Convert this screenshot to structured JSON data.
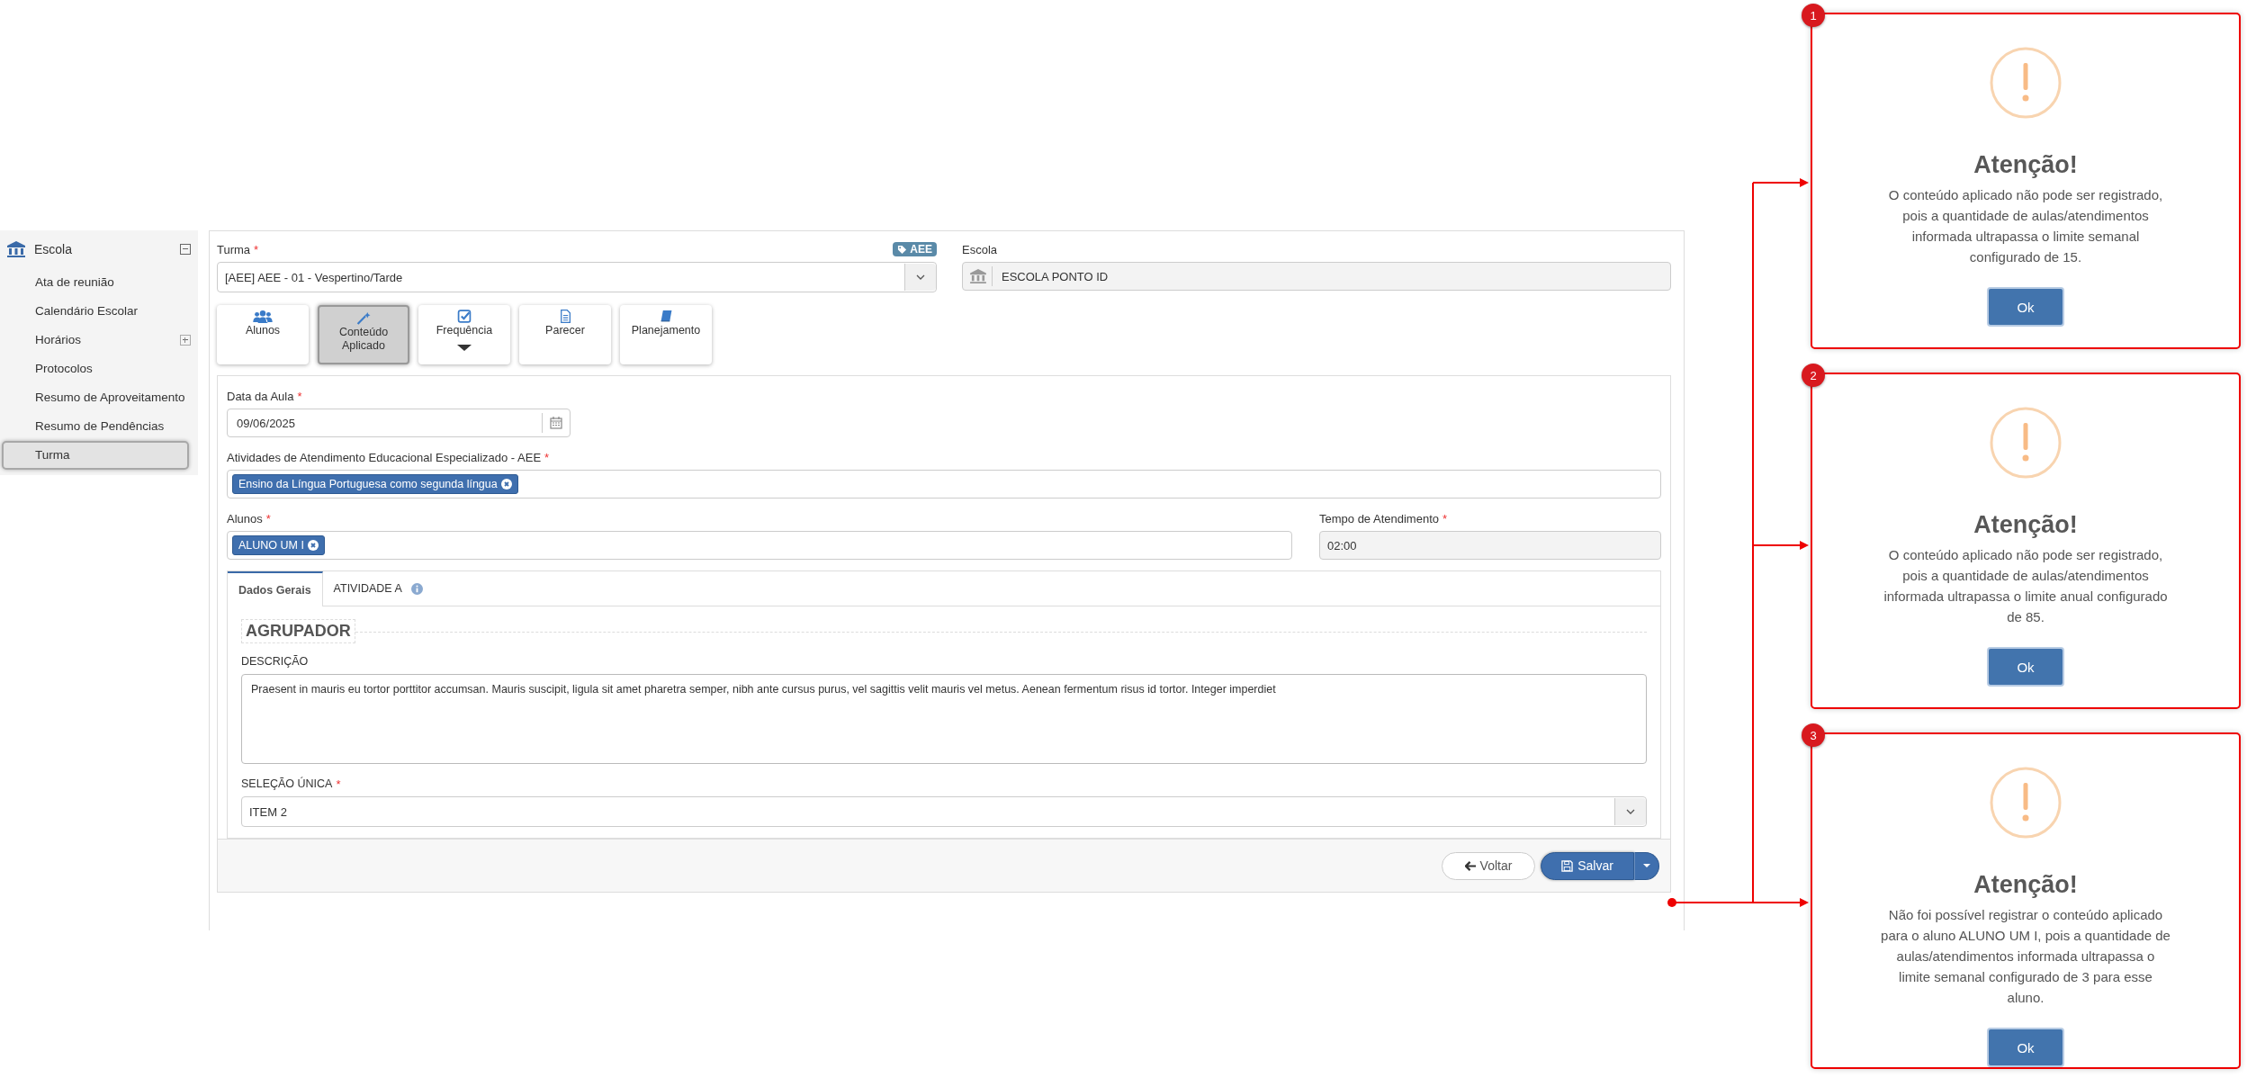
{
  "sidebar": {
    "header": {
      "label": "Escola",
      "expanded": true
    },
    "items": [
      {
        "label": "Ata de reunião",
        "selected": false,
        "expandable": false
      },
      {
        "label": "Calendário Escolar",
        "selected": false,
        "expandable": false
      },
      {
        "label": "Horários",
        "selected": false,
        "expandable": true
      },
      {
        "label": "Protocolos",
        "selected": false,
        "expandable": false
      },
      {
        "label": "Resumo de Aproveitamento",
        "selected": false,
        "expandable": false
      },
      {
        "label": "Resumo de Pendências",
        "selected": false,
        "expandable": false
      },
      {
        "label": "Turma",
        "selected": true,
        "expandable": false
      }
    ]
  },
  "turma": {
    "label": "Turma",
    "required_mark": "*",
    "badge": "AEE",
    "value": "[AEE]  AEE - 01 - Vespertino/Tarde"
  },
  "escola": {
    "label": "Escola",
    "value": "ESCOLA PONTO ID"
  },
  "actions": [
    {
      "label": "Alunos",
      "kind": "users",
      "selected": false,
      "dropdown": false
    },
    {
      "label": "Conteúdo Aplicado",
      "kind": "wand",
      "selected": true,
      "dropdown": false
    },
    {
      "label": "Frequência",
      "kind": "check",
      "selected": false,
      "dropdown": true
    },
    {
      "label": "Parecer",
      "kind": "document",
      "selected": false,
      "dropdown": false
    },
    {
      "label": "Planejamento",
      "kind": "book",
      "selected": false,
      "dropdown": false
    }
  ],
  "data_aula": {
    "label": "Data da Aula",
    "required_mark": "*",
    "value": "09/06/2025"
  },
  "atividades": {
    "label": "Atividades de Atendimento Educacional Especializado - AEE",
    "required_mark": "*",
    "tags": [
      "Ensino da Língua Portuguesa como segunda língua"
    ]
  },
  "alunos": {
    "label": "Alunos",
    "required_mark": "*",
    "tags": [
      "ALUNO UM I"
    ]
  },
  "tempo": {
    "label": "Tempo de Atendimento",
    "required_mark": "*",
    "value": "02:00"
  },
  "tabs": [
    {
      "label": "Dados Gerais",
      "selected": true,
      "info": false
    },
    {
      "label": "ATIVIDADE A",
      "selected": false,
      "info": true
    }
  ],
  "group_title": "AGRUPADOR",
  "descricao": {
    "label": "DESCRIÇÃO",
    "value": "Praesent in mauris eu tortor porttitor accumsan. Mauris suscipit, ligula sit amet pharetra semper, nibh ante cursus purus, vel sagittis velit mauris vel metus. Aenean fermentum risus id tortor. Integer imperdiet"
  },
  "selecao": {
    "label": "SELEÇÃO ÚNICA",
    "required_mark": "*",
    "value": "ITEM 2"
  },
  "footer": {
    "back": "Voltar",
    "save": "Salvar"
  },
  "dialogs": [
    {
      "number": "1",
      "title": "Atenção!",
      "message": "O conteúdo aplicado não pode ser registrado, pois a quantidade de aulas/atendimentos informada ultrapassa o limite semanal configurado de 15.",
      "button": "Ok"
    },
    {
      "number": "2",
      "title": "Atenção!",
      "message": "O conteúdo aplicado não pode ser registrado, pois a quantidade de aulas/atendimentos informada ultrapassa o limite anual configurado de 85.",
      "button": "Ok"
    },
    {
      "number": "3",
      "title": "Atenção!",
      "message": "Não foi possível registrar o conteúdo aplicado para o aluno ALUNO UM I, pois a quantidade de aulas/atendimentos informada ultrapassa o limite semanal configurado de 3 para esse aluno.",
      "button": "Ok"
    }
  ]
}
